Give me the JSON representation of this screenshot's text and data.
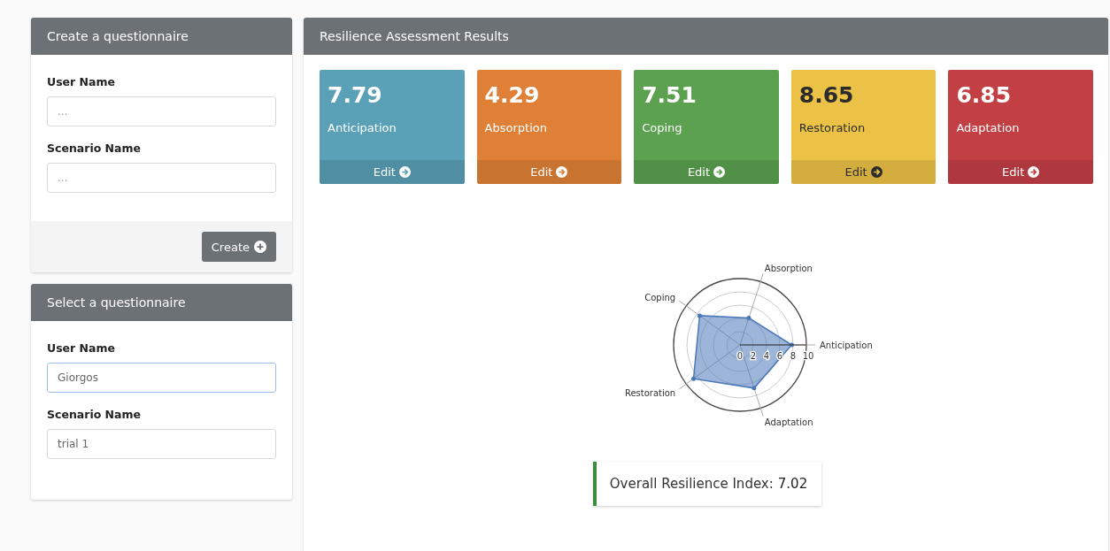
{
  "create_panel": {
    "title": "Create a questionnaire",
    "fields": [
      {
        "label": "User Name",
        "placeholder": "...",
        "focused": false
      },
      {
        "label": "Scenario Name",
        "placeholder": "...",
        "focused": false
      }
    ],
    "button": "Create"
  },
  "select_panel": {
    "title": "Select a questionnaire",
    "fields": [
      {
        "label": "User Name",
        "value": "Giorgos",
        "focused": true
      },
      {
        "label": "Scenario Name",
        "value": "trial 1",
        "focused": false
      }
    ]
  },
  "results_panel": {
    "title": "Resilience Assessment Results",
    "cards": [
      {
        "value": "7.79",
        "label": "Anticipation",
        "action": "Edit",
        "color": "#5aa0b6"
      },
      {
        "value": "4.29",
        "label": "Absorption",
        "action": "Edit",
        "color": "#e08037"
      },
      {
        "value": "7.51",
        "label": "Coping",
        "action": "Edit",
        "color": "#5ba150"
      },
      {
        "value": "8.65",
        "label": "Restoration",
        "action": "Edit",
        "color": "#ebc246"
      },
      {
        "value": "6.85",
        "label": "Adaptation",
        "action": "Edit",
        "color": "#c23f44"
      }
    ],
    "chart_data": {
      "type": "radar",
      "categories": [
        "Absorption",
        "Anticipation",
        "Adaptation",
        "Restoration",
        "Coping"
      ],
      "series": [
        {
          "color": "#4a78b8",
          "values": [
            4.29,
            7.79,
            6.85,
            8.65,
            7.51
          ]
        }
      ],
      "ylim": [
        0,
        10
      ],
      "yticks": [
        0,
        2,
        4,
        6,
        8,
        10
      ]
    },
    "overall": {
      "label": "Overall Resilience Index:",
      "value": "7.02"
    }
  }
}
